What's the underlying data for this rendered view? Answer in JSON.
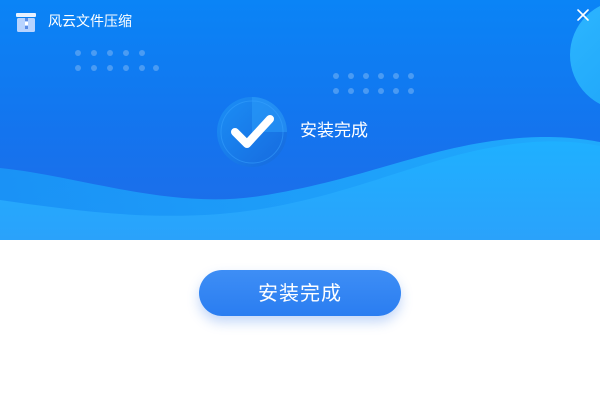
{
  "app": {
    "title": "风云文件压缩",
    "logo_icon": "zip-archive-icon"
  },
  "window_controls": {
    "close_icon": "close-icon"
  },
  "status": {
    "icon": "checkmark-icon",
    "text": "安装完成"
  },
  "actions": {
    "primary_label": "安装完成"
  },
  "colors": {
    "banner_top": "#0a84f6",
    "banner_bottom": "#1f6ce8",
    "wave": "#1ba7ff",
    "button": "#3085f3",
    "background": "#ffffff"
  }
}
